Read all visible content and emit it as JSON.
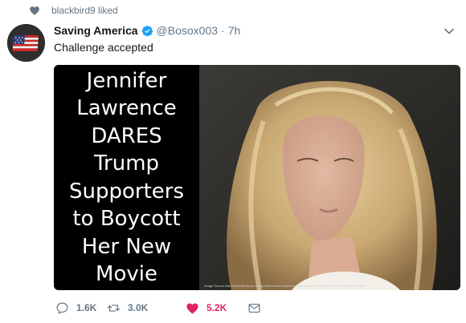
{
  "social_context": {
    "text": "blackbird9 liked",
    "icon": "heart-icon"
  },
  "tweet": {
    "author": {
      "display_name": "Saving America",
      "handle": "@Bosox003",
      "verified": true
    },
    "separator": "·",
    "time": "7h",
    "text": "Challenge accepted",
    "media": {
      "headline": "Jennifer\nLawrence\nDARES\nTrump\nSupporters\nto Boycott\nHer New\nMovie",
      "photo_credit": "Image Source http://www.facebook.com/jenniferlawrence/photos/ and opinion from twitter account @Vive_Donald"
    },
    "actions": {
      "reply_count": "1.6K",
      "retweet_count": "3.0K",
      "like_count": "5.2K",
      "liked": true
    }
  },
  "colors": {
    "like_accent": "#e0245e",
    "verified_blue": "#1da1f2",
    "secondary_text": "#657786"
  }
}
